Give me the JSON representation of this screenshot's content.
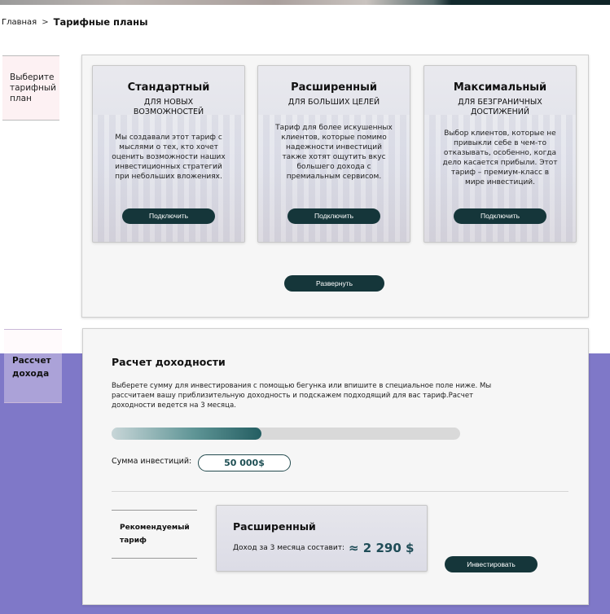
{
  "breadcrumb": {
    "home": "Главная",
    "separator": ">",
    "current": "Тарифные планы"
  },
  "sidebar": {
    "choose_plan": "Выберите тарифный план",
    "calc_income": "Рассчет дохода"
  },
  "plans": [
    {
      "name": "Стандартный",
      "subtitle": "ДЛЯ НОВЫХ ВОЗМОЖНОСТЕЙ",
      "description": "Мы создавали этот тариф с мыслями о тех, кто хочет оценить возможности наших инвестиционных стратегий при небольших вложениях.",
      "button": "Подключить"
    },
    {
      "name": "Расширенный",
      "subtitle": "ДЛЯ БОЛЬШИХ ЦЕЛЕЙ",
      "description": "Тариф для более искушенных клиентов, которые помимо надежности инвестиций также хотят ощутить вкус большего дохода с премиальным сервисом.",
      "button": "Подключить"
    },
    {
      "name": "Максимальный",
      "subtitle": "ДЛЯ БЕЗГРАНИЧНЫХ ДОСТИЖЕНИЙ",
      "description": "Выбор клиентов, которые не привыкли себе в чем-то отказывать, особенно, когда дело касается прибыли. Этот тариф – премиум-класс в мире инвестиций.",
      "button": "Подключить"
    }
  ],
  "expand_button": "Развернуть",
  "calculator": {
    "title": "Расчет доходности",
    "description": "Выберете сумму для инвестирования с помощью бегунка или впишите в специальное поле ниже. Мы рассчитаем вашу приблизительную доходность и подскажем подходящий для вас тариф.Расчет доходности ведется на 3 месяца.",
    "slider_fraction": 0.43,
    "sum_label": "Сумма инвестиций:",
    "sum_value": "50 000$",
    "recommended_label": "Рекомендуемый тариф",
    "recommended_plan": "Расширенный",
    "income_label": "Доход за 3 месяца составит:",
    "income_value": "≈ 2 290 $",
    "invest_button": "Инвестировать"
  },
  "colors": {
    "accent_dark": "#15363a",
    "purple_band": "#7f78c8",
    "value_text": "#1e4f54"
  }
}
